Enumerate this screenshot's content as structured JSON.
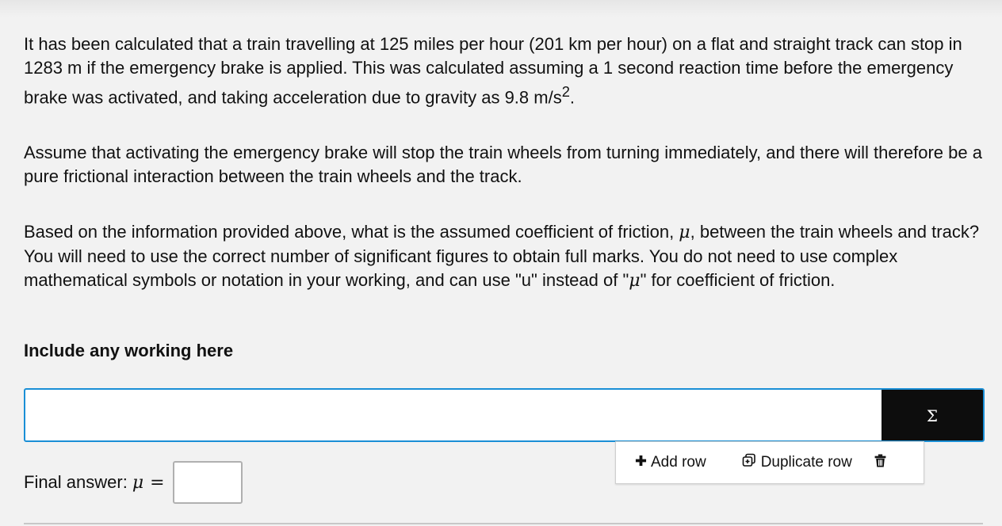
{
  "question": {
    "p1_part1": "It has been calculated that a train travelling at 125 miles per hour (201 km per hour) on a flat and straight track can stop in 1283 m if the emergency brake is applied.  This was calculated assuming a 1 second reaction time before the emergency brake was activated, and taking acceleration due to gravity as 9.8 m/s",
    "p1_sup": "2",
    "p1_end": ".",
    "p2": "Assume that activating the emergency brake will stop the train wheels from turning immediately, and there will therefore be a pure frictional interaction between the train wheels and the track.",
    "p3_part1": "Based on the information provided above, what is the assumed coefficient of friction, ",
    "mu_symbol": "μ",
    "p3_part2": ", between the train wheels and track?  You will need to use the correct number of significant figures to obtain full marks. You do not need to use complex mathematical symbols or notation in your working, and can use \"u\" instead of \"",
    "p3_part3": "\" for coefficient of friction."
  },
  "working": {
    "label": "Include any working here",
    "input_value": "",
    "sigma_label": "Σ"
  },
  "toolbar": {
    "add_icon": "✚",
    "add_label": "Add row",
    "duplicate_label": "Duplicate row",
    "icons": {
      "add": "plus-icon",
      "duplicate": "duplicate-icon",
      "delete": "trash-icon"
    }
  },
  "final": {
    "label": "Final answer:",
    "mu_symbol": "μ",
    "equals": "=",
    "input_value": ""
  },
  "colors": {
    "accent_border": "#1a8fd6",
    "sigma_bg": "#0d0d0d",
    "page_bg": "#f2f2f2"
  }
}
